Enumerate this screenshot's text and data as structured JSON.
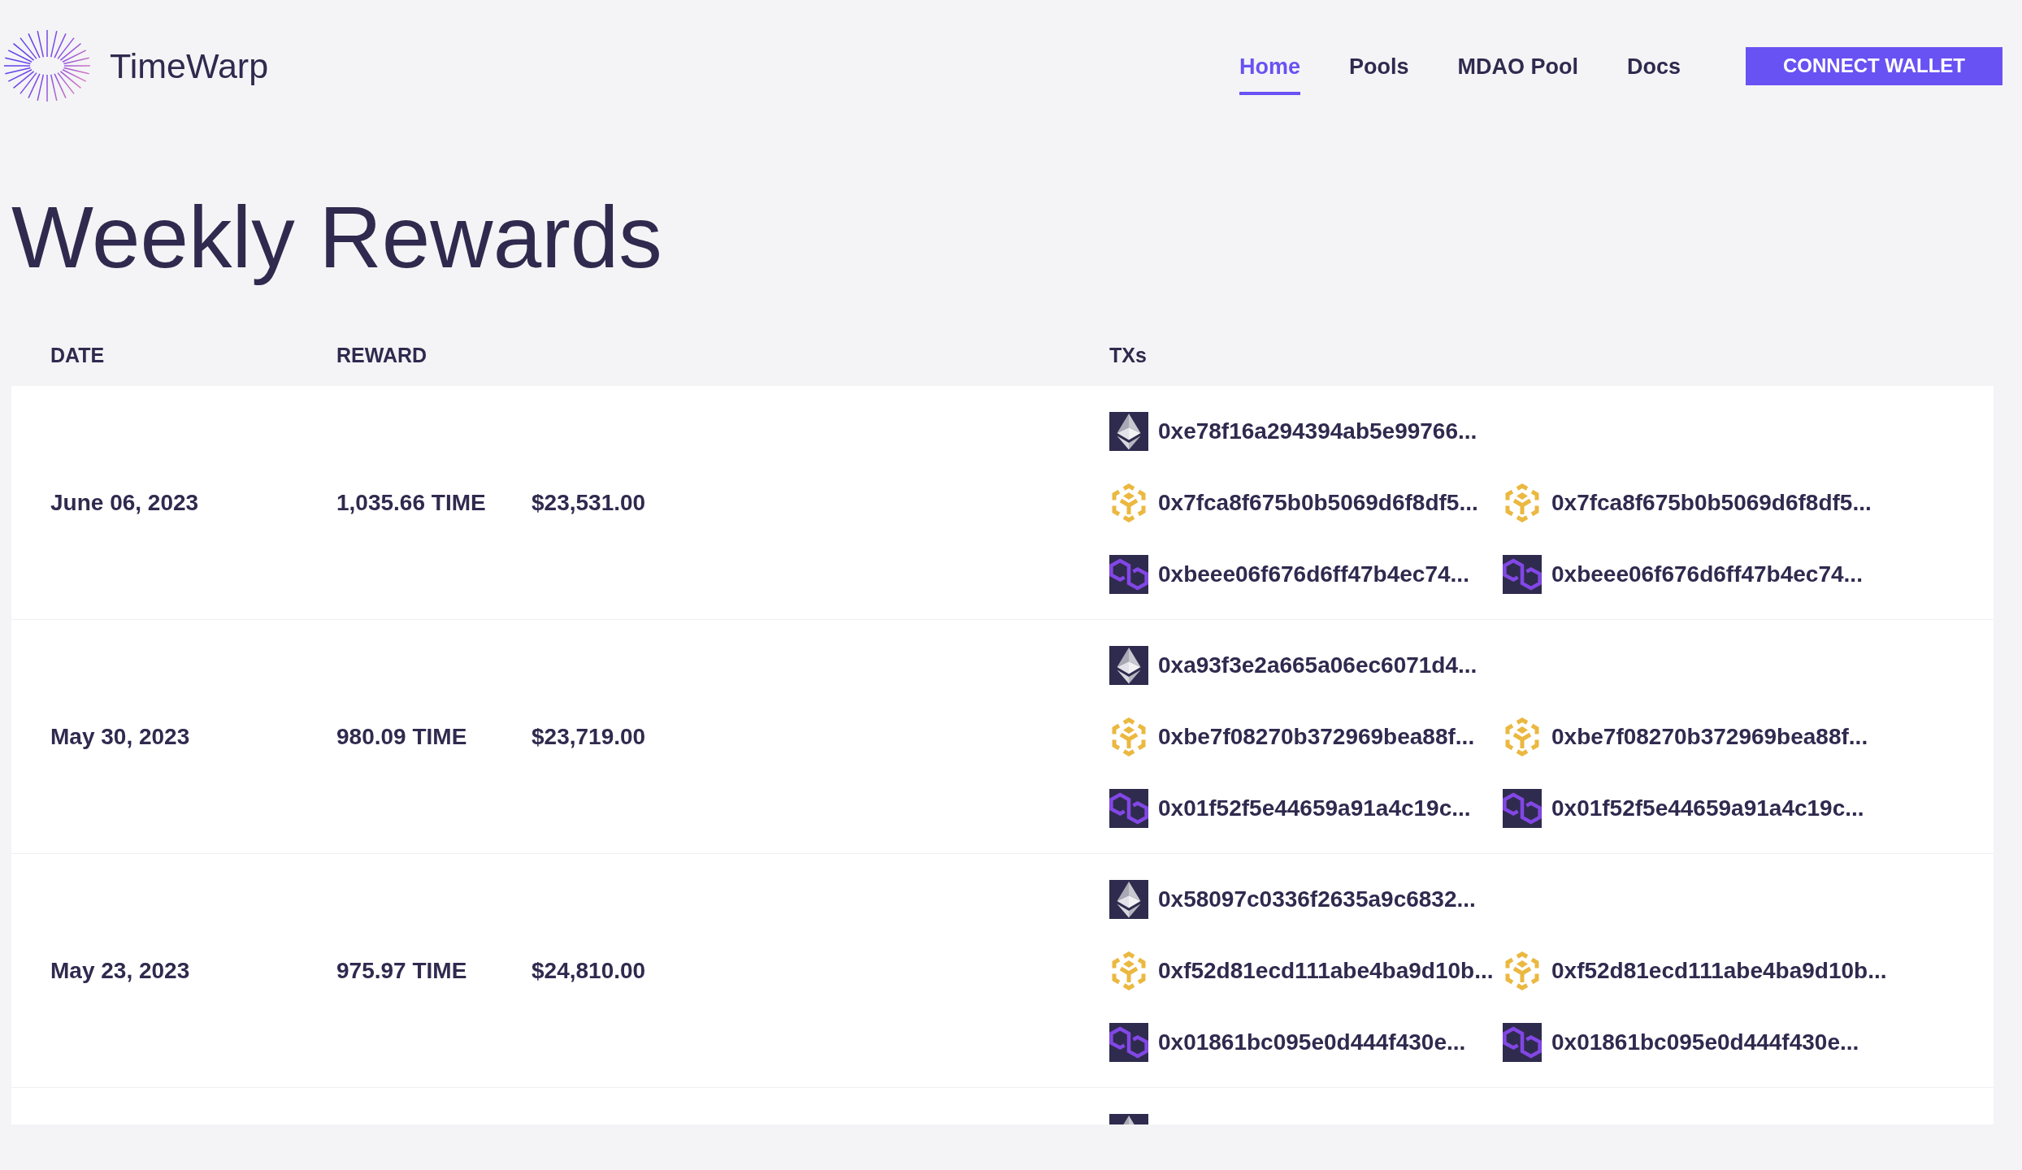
{
  "header": {
    "brand": "TimeWarp",
    "nav": [
      {
        "label": "Home",
        "selected": true
      },
      {
        "label": "Pools",
        "selected": false
      },
      {
        "label": "MDAO Pool",
        "selected": false
      },
      {
        "label": "Docs",
        "selected": false
      }
    ],
    "connect_button": "CONNECT WALLET"
  },
  "page_title": "Weekly Rewards",
  "table": {
    "columns": [
      "DATE",
      "REWARD",
      "TXs"
    ],
    "rows": [
      {
        "date": "June 06, 2023",
        "reward": "1,035.66 TIME",
        "reward_usd": "$23,531.00",
        "tx_lines": [
          {
            "items": [
              {
                "kind": "ethereum",
                "hash": "0xe78f16a294394ab5e99766..."
              }
            ]
          },
          {
            "items": [
              {
                "kind": "bnb",
                "hash": "0x7fca8f675b0b5069d6f8df5..."
              },
              {
                "kind": "bnb",
                "hash": "0x7fca8f675b0b5069d6f8df5..."
              }
            ]
          },
          {
            "items": [
              {
                "kind": "polygon",
                "hash": "0xbeee06f676d6ff47b4ec74..."
              },
              {
                "kind": "polygon",
                "hash": "0xbeee06f676d6ff47b4ec74..."
              }
            ]
          }
        ]
      },
      {
        "date": "May 30, 2023",
        "reward": "980.09 TIME",
        "reward_usd": "$23,719.00",
        "tx_lines": [
          {
            "items": [
              {
                "kind": "ethereum",
                "hash": "0xa93f3e2a665a06ec6071d4..."
              }
            ]
          },
          {
            "items": [
              {
                "kind": "bnb",
                "hash": "0xbe7f08270b372969bea88f..."
              },
              {
                "kind": "bnb",
                "hash": "0xbe7f08270b372969bea88f..."
              }
            ]
          },
          {
            "items": [
              {
                "kind": "polygon",
                "hash": "0x01f52f5e44659a91a4c19c..."
              },
              {
                "kind": "polygon",
                "hash": "0x01f52f5e44659a91a4c19c..."
              }
            ]
          }
        ]
      },
      {
        "date": "May 23, 2023",
        "reward": "975.97 TIME",
        "reward_usd": "$24,810.00",
        "tx_lines": [
          {
            "items": [
              {
                "kind": "ethereum",
                "hash": "0x58097c0336f2635a9c6832..."
              }
            ]
          },
          {
            "items": [
              {
                "kind": "bnb",
                "hash": "0xf52d81ecd111abe4ba9d10b..."
              },
              {
                "kind": "bnb",
                "hash": "0xf52d81ecd111abe4ba9d10b..."
              }
            ]
          },
          {
            "items": [
              {
                "kind": "polygon",
                "hash": "0x01861bc095e0d444f430e..."
              },
              {
                "kind": "polygon",
                "hash": "0x01861bc095e0d444f430e..."
              }
            ]
          }
        ]
      },
      {
        "tx_lines": [
          {
            "items": [
              {
                "kind": "ethereum"
              }
            ]
          }
        ]
      }
    ]
  }
}
